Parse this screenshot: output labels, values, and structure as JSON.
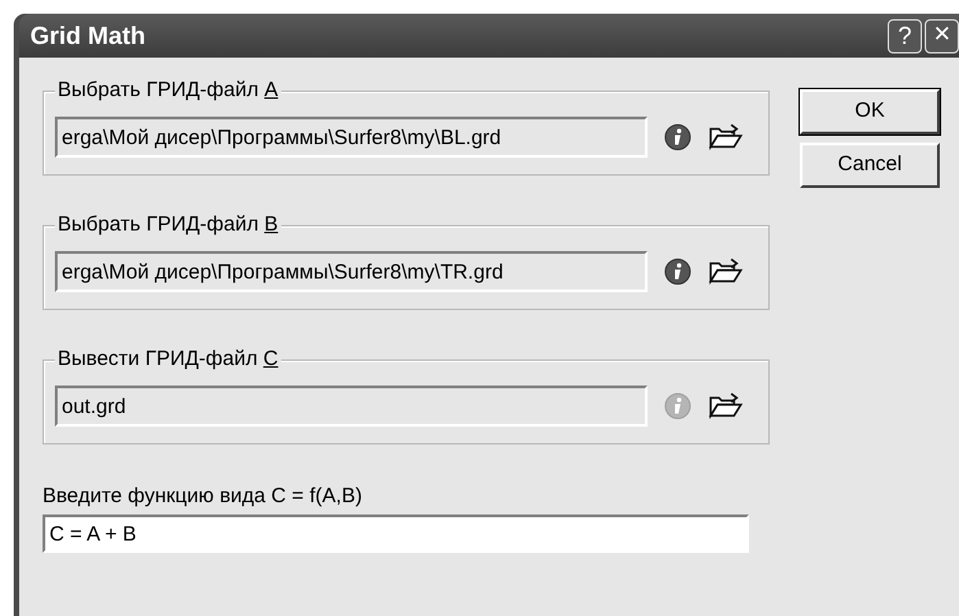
{
  "window": {
    "title": "Grid Math",
    "help_button": "?",
    "close_button": "✕"
  },
  "file_groups": [
    {
      "label": "Выбрать ГРИД-файл ",
      "accelerator": "A",
      "value": "erga\\Мой дисер\\Программы\\Surfer8\\my\\BL.grd",
      "info_enabled": true
    },
    {
      "label": "Выбрать ГРИД-файл ",
      "accelerator": "B",
      "value": "erga\\Мой дисер\\Программы\\Surfer8\\my\\TR.grd",
      "info_enabled": true
    },
    {
      "label": "Вывести ГРИД-файл ",
      "accelerator": "C",
      "value": "out.grd",
      "info_enabled": false
    }
  ],
  "function": {
    "label": "Введите функцию вида C = f(A,B)",
    "value": "C = A + B"
  },
  "buttons": [
    {
      "label": "OK",
      "default": true
    },
    {
      "label": "Cancel",
      "default": false
    }
  ]
}
